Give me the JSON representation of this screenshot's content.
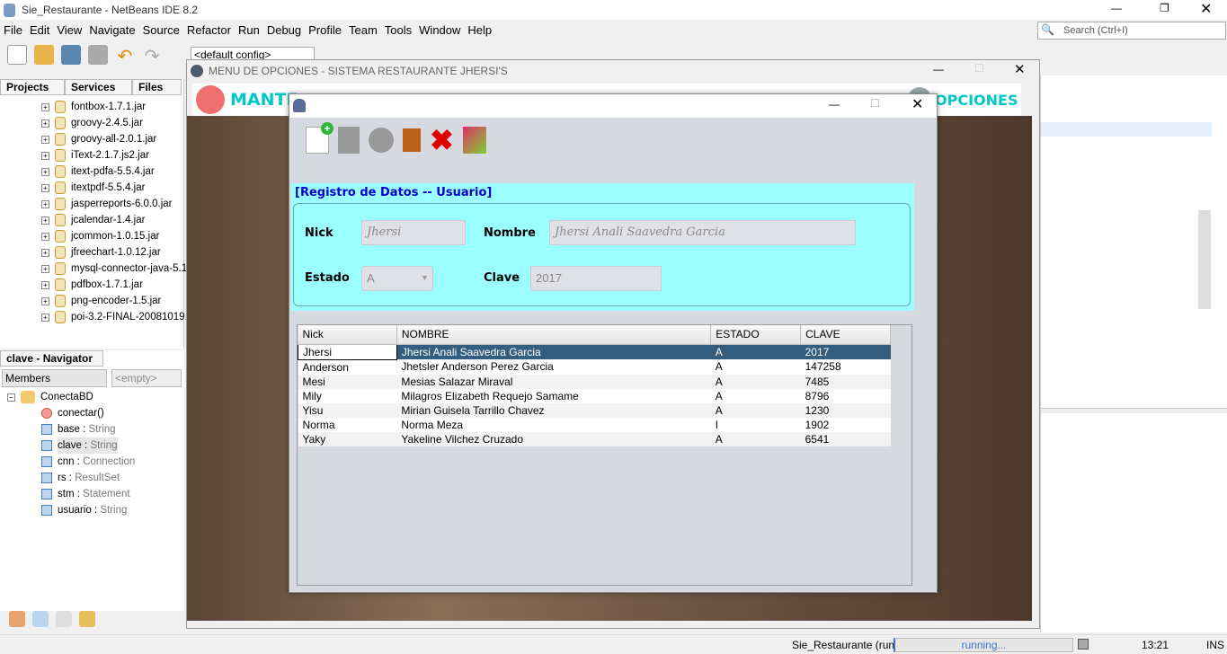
{
  "ide": {
    "title": "Sie_Restaurante - NetBeans IDE 8.2",
    "menu": [
      "File",
      "Edit",
      "View",
      "Navigate",
      "Source",
      "Refactor",
      "Run",
      "Debug",
      "Profile",
      "Team",
      "Tools",
      "Window",
      "Help"
    ],
    "search_placeholder": "Search (Ctrl+I)",
    "config": "<default config>",
    "tabs": [
      "Projects",
      "Services",
      "Files"
    ],
    "jars": [
      "fontbox-1.7.1.jar",
      "groovy-2.4.5.jar",
      "groovy-all-2.0.1.jar",
      "iText-2.1.7.js2.jar",
      "itext-pdfa-5.5.4.jar",
      "itextpdf-5.5.4.jar",
      "jasperreports-6.0.0.jar",
      "jcalendar-1.4.jar",
      "jcommon-1.0.15.jar",
      "jfreechart-1.0.12.jar",
      "mysql-connector-java-5.1",
      "pdfbox-1.7.1.jar",
      "png-encoder-1.5.jar",
      "poi-3.2-FINAL-20081019."
    ],
    "navigator": {
      "title": "clave - Navigator",
      "filter": "Members",
      "empty": "<empty>",
      "root": "ConectaBD",
      "members": [
        {
          "name": "conectar()",
          "type": ""
        },
        {
          "name": "base",
          "type": "String"
        },
        {
          "name": "clave",
          "type": "String"
        },
        {
          "name": "cnn",
          "type": "Connection"
        },
        {
          "name": "rs",
          "type": "ResultSet"
        },
        {
          "name": "stm",
          "type": "Statement"
        },
        {
          "name": "usuario",
          "type": "String"
        }
      ]
    },
    "status": {
      "project": "Sie_Restaurante (run)",
      "progress": "running...",
      "time": "13:21",
      "mode": "INS"
    }
  },
  "menu_window": {
    "title": "MENU DE OPCIONES - SISTEMA RESTAURANTE JHERSI'S",
    "items": [
      "MANTE",
      "OPCIONES"
    ]
  },
  "dialog": {
    "section_title": "[Registro de Datos -- Usuario]",
    "labels": {
      "nick": "Nick",
      "nombre": "Nombre",
      "estado": "Estado",
      "clave": "Clave"
    },
    "values": {
      "nick": "Jhersi",
      "nombre": "Jhersi Anali Saavedra Garcia",
      "estado": "A",
      "clave": "2017"
    },
    "table": {
      "headers": [
        "Nick",
        "NOMBRE",
        "ESTADO",
        "CLAVE"
      ],
      "rows": [
        [
          "Jhersi",
          "Jhersi Anali Saavedra Garcia",
          "A",
          "2017"
        ],
        [
          "Anderson",
          "Jhetsler Anderson Perez Garcia",
          "A",
          "147258"
        ],
        [
          "Mesi",
          "Mesias Salazar Miraval",
          "A",
          "7485"
        ],
        [
          "Mily",
          "Milagros Elizabeth Requejo Samame",
          "A",
          "8796"
        ],
        [
          "Yisu",
          "Mirian Guisela Tarrillo Chavez",
          "A",
          "1230"
        ],
        [
          "Norma",
          "Norma Meza",
          "I",
          "1902"
        ],
        [
          "Yaky",
          "Yakeline Vilchez Cruzado",
          "A",
          "6541"
        ]
      ]
    }
  },
  "colors": {
    "panel": "#9cffff",
    "section_title": "#0000cc",
    "menu_text": "#00c8c8",
    "selection": "#345e80"
  }
}
